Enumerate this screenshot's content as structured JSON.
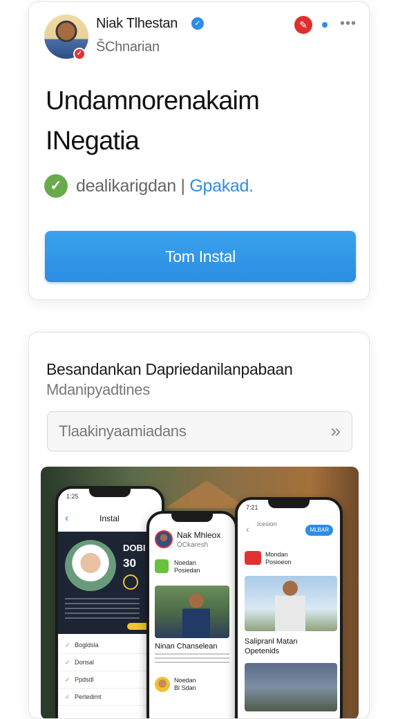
{
  "post": {
    "user_name": "Niak Tlhestan",
    "user_handle": "ŠChnarian",
    "title_line1": "Undamnorenakaim",
    "title_line2": "INegatia",
    "status_text": "dealikarigdan",
    "status_separator": "|",
    "status_link": "Gpakad.",
    "install_label": "Tom Instal"
  },
  "section": {
    "title": "Besandankan Dapriedanilanpabaan",
    "subtitle": "Mdanipyadtines",
    "search_value": "Tlaakinyaamiadans"
  },
  "phones": {
    "p1": {
      "time": "1:25",
      "title": "Instal",
      "big_text": "DOBI",
      "number": "30",
      "rows": [
        "Bogldsla",
        "Dorisal",
        "Ppdsdl",
        "Pertedimt"
      ]
    },
    "p2": {
      "name": "Nak Mhleox",
      "handle": "ÓCkaresh",
      "item_title": "Noedan",
      "item_sub": "Posiedan",
      "caption": "Ninan Chanselean",
      "item2_title": "Noedan",
      "item2_sub": "Bl Sdan"
    },
    "p3": {
      "time": "7:21",
      "section": "Icesion",
      "pill": "MLBAR",
      "item_title": "Mondan",
      "item_sub": "Posioeon",
      "caption_line1": "Salipranl Matan",
      "caption_line2": "Opetenids"
    }
  },
  "icons": {
    "verified": "verified-check-icon",
    "pin": "pin-icon",
    "more": "more-dots-icon",
    "check": "check-circle-icon",
    "search_go": "double-chevron-right-icon"
  },
  "colors": {
    "accent": "#2f8de4",
    "install": "#2b8de2",
    "check": "#69ab4c",
    "pin": "#e02e2e"
  }
}
